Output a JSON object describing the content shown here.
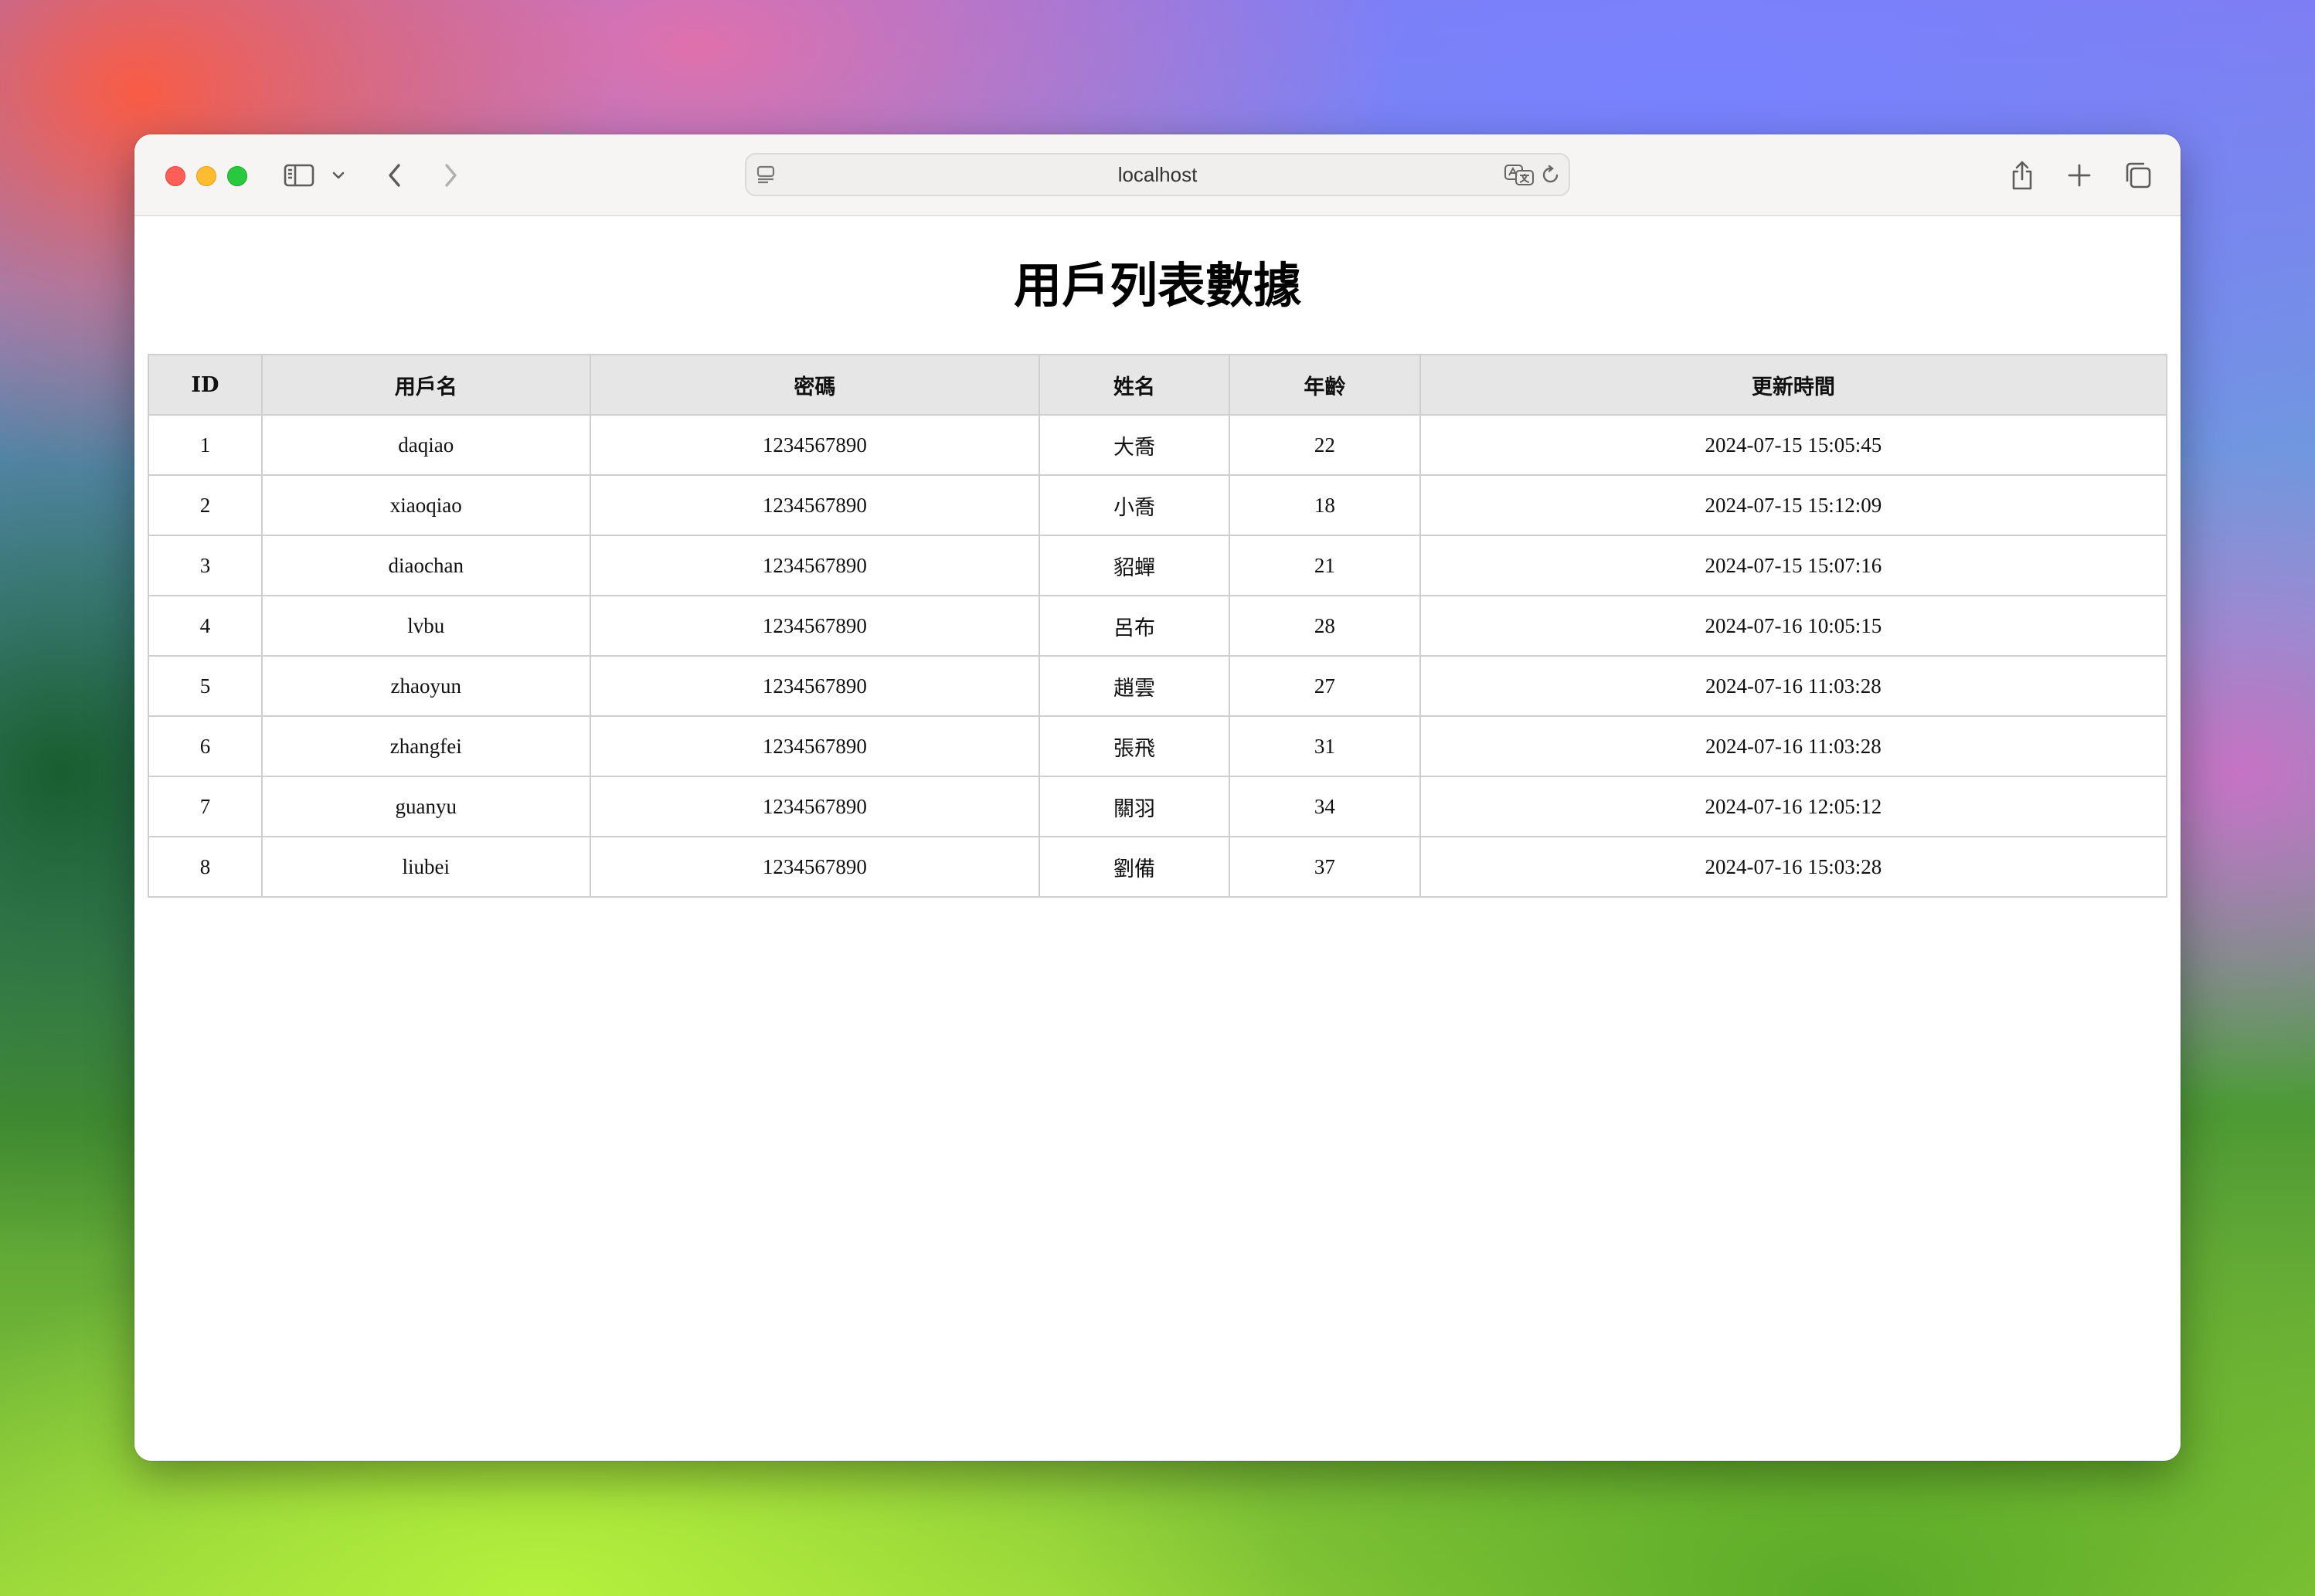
{
  "browser": {
    "address": "localhost"
  },
  "page": {
    "title": "用戶列表數據"
  },
  "table": {
    "headers": [
      "ID",
      "用戶名",
      "密碼",
      "姓名",
      "年齡",
      "更新時間"
    ],
    "rows": [
      [
        "1",
        "daqiao",
        "1234567890",
        "大喬",
        "22",
        "2024-07-15 15:05:45"
      ],
      [
        "2",
        "xiaoqiao",
        "1234567890",
        "小喬",
        "18",
        "2024-07-15 15:12:09"
      ],
      [
        "3",
        "diaochan",
        "1234567890",
        "貂蟬",
        "21",
        "2024-07-15 15:07:16"
      ],
      [
        "4",
        "lvbu",
        "1234567890",
        "呂布",
        "28",
        "2024-07-16 10:05:15"
      ],
      [
        "5",
        "zhaoyun",
        "1234567890",
        "趙雲",
        "27",
        "2024-07-16 11:03:28"
      ],
      [
        "6",
        "zhangfei",
        "1234567890",
        "張飛",
        "31",
        "2024-07-16 11:03:28"
      ],
      [
        "7",
        "guanyu",
        "1234567890",
        "關羽",
        "34",
        "2024-07-16 12:05:12"
      ],
      [
        "8",
        "liubei",
        "1234567890",
        "劉備",
        "37",
        "2024-07-16 15:03:28"
      ]
    ]
  }
}
